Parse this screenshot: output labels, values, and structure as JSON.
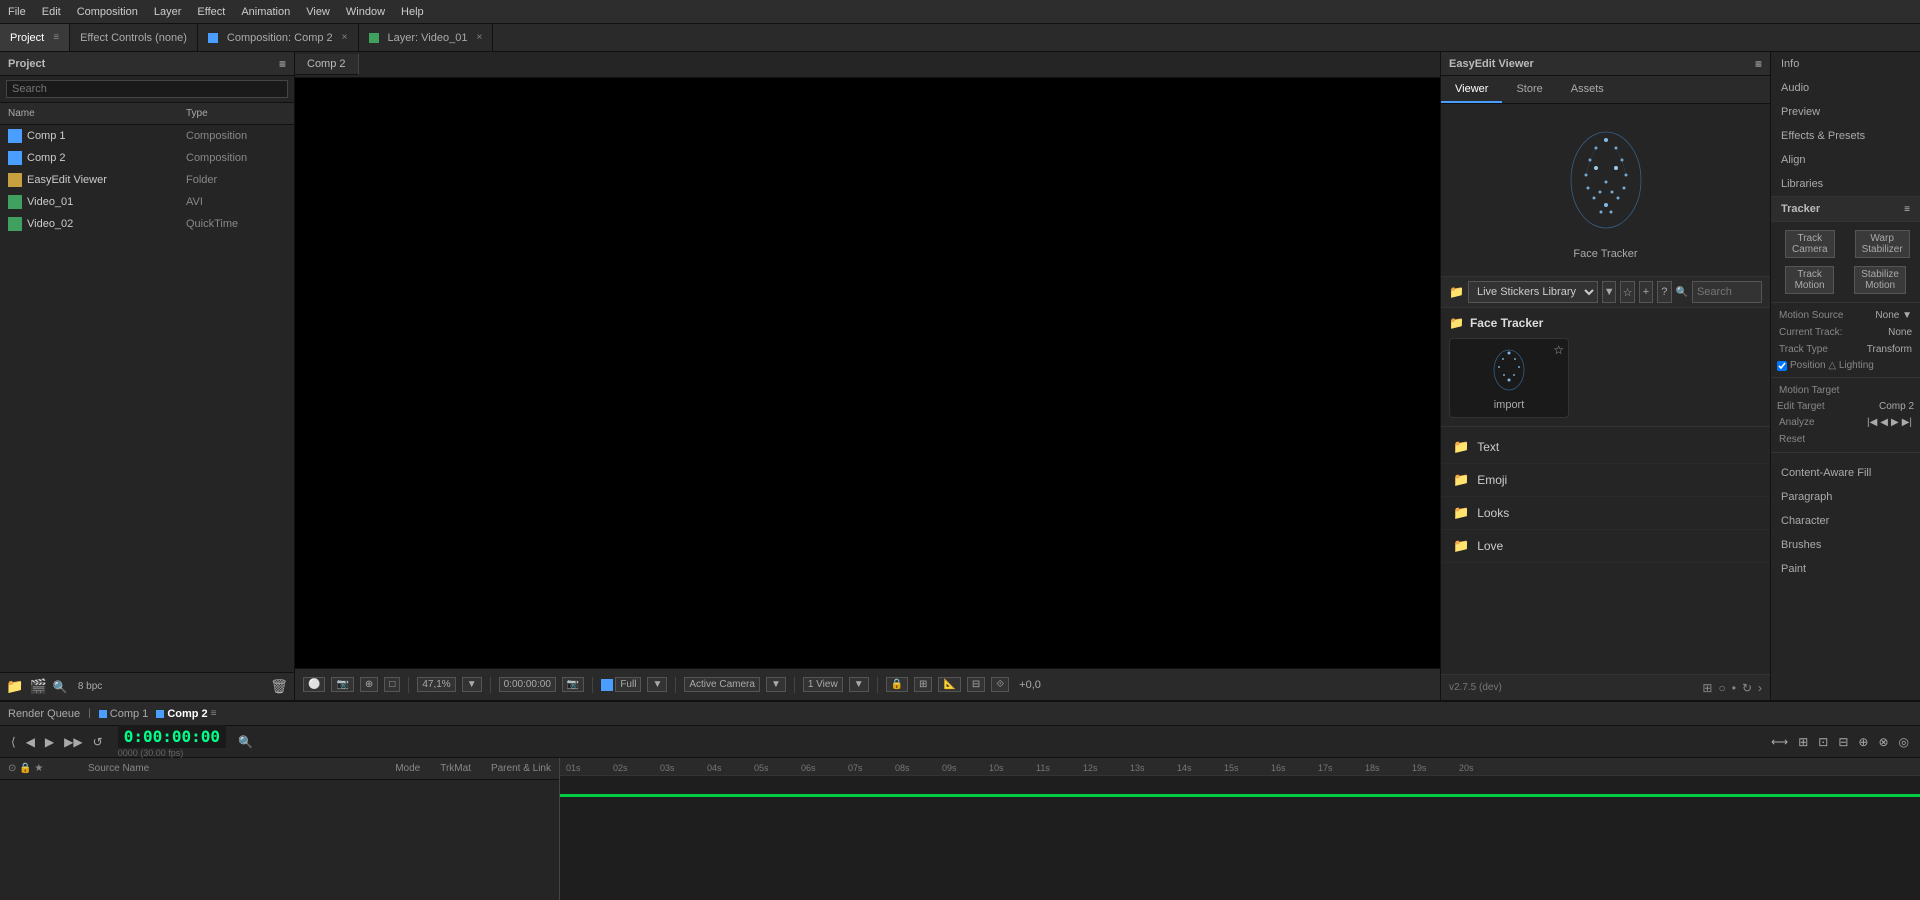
{
  "topbar": {
    "items": [
      "File",
      "Edit",
      "Composition",
      "Layer",
      "Effect",
      "Animation",
      "View",
      "Window",
      "Help"
    ]
  },
  "headerPanels": {
    "projectTab": "Project",
    "effectControlsTab": "Effect Controls (none)",
    "compositionTab": "Composition: Comp 2",
    "layerTab": "Layer: Video_01"
  },
  "leftPanel": {
    "title": "Project",
    "searchPlaceholder": "Search",
    "columns": {
      "name": "Name",
      "type": "Type"
    },
    "items": [
      {
        "name": "Comp 1",
        "type": "Composition",
        "icon": "comp"
      },
      {
        "name": "Comp 2",
        "type": "Composition",
        "icon": "comp"
      },
      {
        "name": "EasyEdit Viewer",
        "type": "Folder",
        "icon": "folder"
      },
      {
        "name": "Video_01",
        "type": "AVI",
        "icon": "avi"
      },
      {
        "name": "Video_02",
        "type": "QuickTime",
        "icon": "qt"
      }
    ]
  },
  "viewer": {
    "title": "EasyEdit Viewer",
    "tabs": {
      "viewer": "Viewer",
      "store": "Store",
      "assets": "Assets"
    },
    "compTab": "Comp 2"
  },
  "viewerControls": {
    "zoomLevel": "47,1%",
    "timeCode": "0:00:00:00",
    "quality": "Full",
    "view": "Active Camera",
    "viewCount": "1 View",
    "renderQueue": "Render Queue",
    "comp1": "Comp 1",
    "comp2": "Comp 2",
    "audio": "+0,0"
  },
  "easyedit": {
    "title": "EasyEdit Viewer",
    "tabs": [
      "Viewer",
      "Store",
      "Assets"
    ],
    "activeTab": "Viewer",
    "faceTracker": {
      "label": "Face Tracker"
    },
    "libraryBar": {
      "label": "Live Stickers Library",
      "searchPlaceholder": "Search"
    },
    "sections": [
      {
        "name": "Face Tracker",
        "items": [
          {
            "label": "import"
          }
        ]
      }
    ],
    "categories": [
      {
        "name": "Text"
      },
      {
        "name": "Emoji"
      },
      {
        "name": "Looks"
      },
      {
        "name": "Love"
      }
    ],
    "footer": {
      "version": "v2.7.5 (dev)",
      "refreshIcon": "↻"
    }
  },
  "farRight": {
    "sections": [
      {
        "label": "Info"
      },
      {
        "label": "Audio"
      },
      {
        "label": "Preview"
      },
      {
        "label": "Effects & Presets"
      },
      {
        "label": "Align"
      },
      {
        "label": "Libraries"
      },
      {
        "label": "Tracker"
      }
    ],
    "tracker": {
      "title": "Tracker",
      "trackCamera": "Track Camera",
      "warpStabilizer": "Warp Stabilizer",
      "trackMotion": "Track Motion",
      "stabilize": "Stabilize Motion",
      "motionSource": "Motion Source",
      "motionSourceValue": "None",
      "currentTrack": "Current Track:",
      "currentTrackValue": "None",
      "trackType": "Track Type",
      "trackTypeValue": "Transform",
      "position": "Position △ Lighting",
      "positionCheck": true,
      "motionTarget": "Motion Target",
      "editTarget": "Edit Target",
      "editTargetValue": "Comp 2",
      "analyze": "Analyze",
      "reset": "Reset"
    },
    "properties": [
      {
        "label": "Content-Aware Fill"
      },
      {
        "label": "Paragraph"
      },
      {
        "label": "Character"
      },
      {
        "label": "Brushes"
      },
      {
        "label": "Paint"
      }
    ]
  },
  "timeline": {
    "timeDisplay": "0:00:00:00",
    "subDisplay": "0000 (30.00 fps)",
    "comp1Label": "Comp 1",
    "comp2Label": "Comp 2",
    "sourceNameLabel": "Source Name",
    "modeLabel": "Mode",
    "trkMatLabel": "TrkMat",
    "parentLabel": "Parent & Link",
    "rulerMarks": [
      "01s",
      "02s",
      "03s",
      "04s",
      "05s",
      "06s",
      "07s",
      "08s",
      "09s",
      "10s",
      "11s",
      "12s",
      "13s",
      "14s",
      "15s",
      "16s",
      "17s",
      "18s",
      "19s",
      "20s"
    ]
  }
}
